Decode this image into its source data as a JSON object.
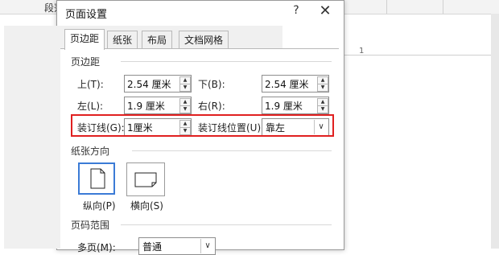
{
  "background": {
    "ribbon_label": "段落",
    "ruler_number": "1"
  },
  "dialog": {
    "title": "页面设置",
    "help_glyph": "?",
    "close_glyph": "✕",
    "tabs": [
      {
        "label": "页边距",
        "active": true
      },
      {
        "label": "纸张",
        "active": false
      },
      {
        "label": "布局",
        "active": false
      },
      {
        "label": "文档网格",
        "active": false
      }
    ],
    "margins": {
      "group_title": "页边距",
      "top_label": "上(T):",
      "top_value": "2.54 厘米",
      "bottom_label": "下(B):",
      "bottom_value": "2.54 厘米",
      "left_label": "左(L):",
      "left_value": "1.9 厘米",
      "right_label": "右(R):",
      "right_value": "1.9 厘米",
      "gutter_label": "装订线(G):",
      "gutter_value": "1厘米",
      "gutter_pos_label": "装订线位置(U):",
      "gutter_pos_value": "靠左"
    },
    "orientation": {
      "group_title": "纸张方向",
      "portrait_label": "纵向(P)",
      "landscape_label": "横向(S)",
      "selected": "portrait"
    },
    "pages": {
      "group_title": "页码范围",
      "multiple_label": "多页(M):",
      "multiple_value": "普通"
    },
    "highlight_color": "#e02020"
  }
}
